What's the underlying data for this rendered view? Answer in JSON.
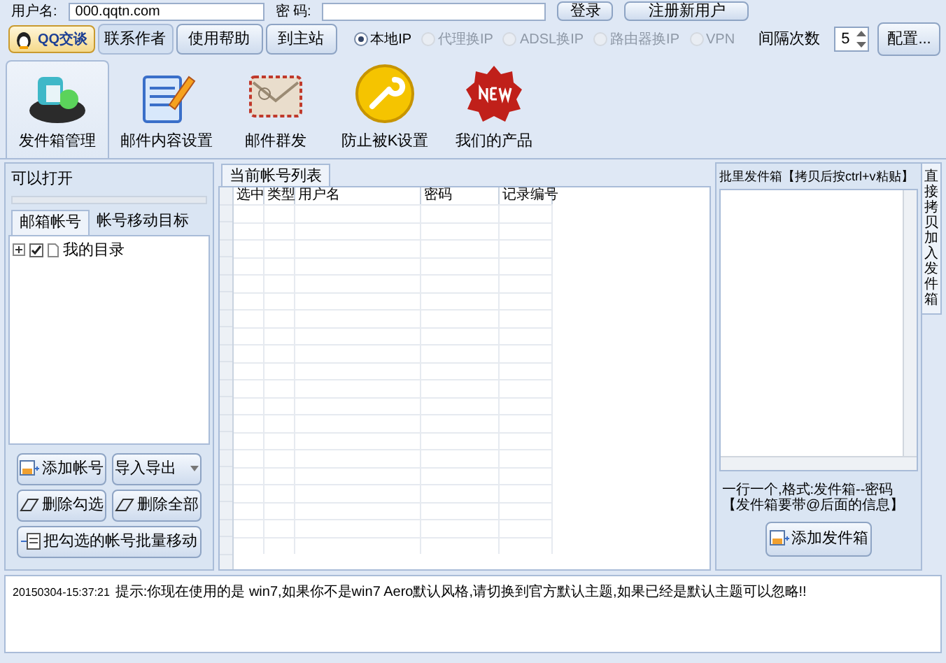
{
  "login_bar": {
    "username_label": "用户名:",
    "username_value": "000.qqtn.com",
    "password_label": "密 码:",
    "login_button": "登录",
    "register_button": "注册新用户"
  },
  "toolbar": {
    "buttons": [
      {
        "kind": "qq",
        "label": "QQ交谈"
      },
      {
        "kind": "plain",
        "label": "联系作者"
      },
      {
        "kind": "raised",
        "label": "使用帮助"
      },
      {
        "kind": "raised",
        "label": "到主站"
      }
    ],
    "ip_modes": [
      {
        "label": "本地IP",
        "selected": true,
        "disabled": false
      },
      {
        "label": "代理换IP",
        "selected": false,
        "disabled": true
      },
      {
        "label": "ADSL换IP",
        "selected": false,
        "disabled": true
      },
      {
        "label": "路由器换IP",
        "selected": false,
        "disabled": true
      },
      {
        "label": "VPN",
        "selected": false,
        "disabled": true
      }
    ],
    "interval_label": "间隔次数",
    "interval_value": "5",
    "config_button": "配置..."
  },
  "ribbon_tabs": [
    {
      "kind": "outbox",
      "label": "发件箱管理",
      "selected": true
    },
    {
      "kind": "compose",
      "label": "邮件内容设置",
      "selected": false
    },
    {
      "kind": "mail",
      "label": "邮件群发",
      "selected": false
    },
    {
      "kind": "wrench",
      "label": "防止被K设置",
      "selected": false
    },
    {
      "kind": "new",
      "label": "我们的产品",
      "selected": false
    }
  ],
  "left_panel": {
    "title": "可以打开",
    "tabs": [
      {
        "label": "邮箱帐号",
        "selected": true
      },
      {
        "label": "帐号移动目标",
        "selected": false
      }
    ],
    "tree": [
      {
        "label": "我的目录",
        "checked": true,
        "expanded": false
      }
    ],
    "buttons": [
      {
        "kind": "add",
        "label": "添加帐号"
      },
      {
        "kind": "dropdown",
        "label": "导入导出"
      },
      {
        "kind": "erase",
        "label": "删除勾选"
      },
      {
        "kind": "erase",
        "label": "删除全部"
      },
      {
        "kind": "move",
        "label": "把勾选的帐号批量移动"
      }
    ]
  },
  "account_list": {
    "tab": "当前帐号列表",
    "columns": [
      "选中",
      "类型",
      "用户名",
      "密码",
      "记录编号"
    ]
  },
  "right_panel": {
    "box_label": "批里发件箱【拷贝后按ctrl+v粘贴】",
    "hint": "一行一个,格式:发件箱--密码【发件箱要带@后面的信息】",
    "add_button": "添加发件箱",
    "side_tab": {
      "label": "直接拷贝加入发件箱",
      "selected": true
    }
  },
  "log": [
    {
      "time": "20150304-15:37:21",
      "message": "提示:你现在使用的是 win7,如果你不是win7 Aero默认风格,请切换到官方默认主题,如果已经是默认主题可以忽略!!"
    }
  ]
}
